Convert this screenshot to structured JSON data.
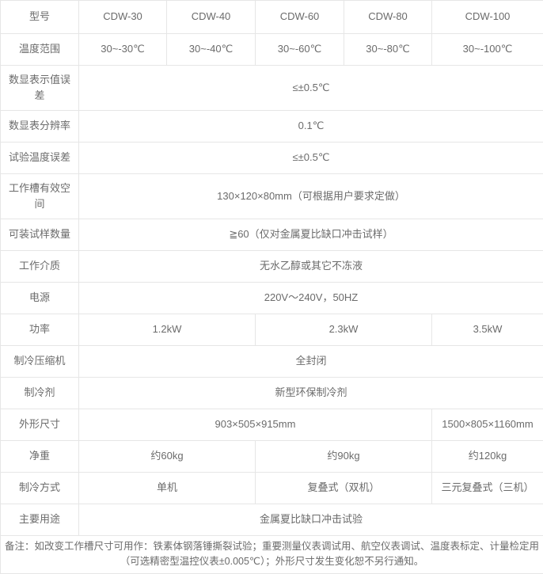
{
  "table": {
    "columns_count": 6,
    "header": {
      "label": "型号",
      "models": [
        "CDW-30",
        "CDW-40",
        "CDW-60",
        "CDW-80",
        "CDW-100"
      ]
    },
    "rows": [
      {
        "id": "temp-range",
        "label": "温度范围",
        "cells": [
          {
            "text": "30~-30℃",
            "span": 1
          },
          {
            "text": "30~-40℃",
            "span": 1
          },
          {
            "text": "30~-60℃",
            "span": 1
          },
          {
            "text": "30~-80℃",
            "span": 1
          },
          {
            "text": "30~-100℃",
            "span": 1
          }
        ]
      },
      {
        "id": "display-error",
        "label": "数显表示值误差",
        "tall": true,
        "cells": [
          {
            "text": "≤±0.5℃",
            "span": 5
          }
        ]
      },
      {
        "id": "display-resolution",
        "label": "数显表分辨率",
        "cells": [
          {
            "text": "0.1℃",
            "span": 5
          }
        ]
      },
      {
        "id": "test-temp-error",
        "label": "试验温度误差",
        "cells": [
          {
            "text": "≤±0.5℃",
            "span": 5
          }
        ]
      },
      {
        "id": "working-space",
        "label": "工作槽有效空间",
        "tall": true,
        "cells": [
          {
            "text": "130×120×80mm（可根据用户要求定做）",
            "span": 5
          }
        ]
      },
      {
        "id": "sample-capacity",
        "label": "可装试样数量",
        "cells": [
          {
            "text": "≧60（仅对金属夏比缺口冲击试样）",
            "span": 5
          }
        ]
      },
      {
        "id": "working-medium",
        "label": "工作介质",
        "cells": [
          {
            "text": "无水乙醇或其它不冻液",
            "span": 5
          }
        ]
      },
      {
        "id": "power-supply",
        "label": "电源",
        "cells": [
          {
            "text": "220V～240V，50HZ",
            "span": 5
          }
        ]
      },
      {
        "id": "power-rating",
        "label": "功率",
        "cells": [
          {
            "text": "1.2kW",
            "span": 2
          },
          {
            "text": "2.3kW",
            "span": 2
          },
          {
            "text": "3.5kW",
            "span": 1
          }
        ]
      },
      {
        "id": "compressor",
        "label": "制冷压缩机",
        "cells": [
          {
            "text": "全封闭",
            "span": 5
          }
        ]
      },
      {
        "id": "refrigerant",
        "label": "制冷剂",
        "cells": [
          {
            "text": "新型环保制冷剂",
            "span": 5
          }
        ]
      },
      {
        "id": "dimensions",
        "label": "外形尺寸",
        "cells": [
          {
            "text": "903×505×915mm",
            "span": 4
          },
          {
            "text": "1500×805×1160mm",
            "span": 1
          }
        ]
      },
      {
        "id": "net-weight",
        "label": "净重",
        "cells": [
          {
            "text": "约60kg",
            "span": 2
          },
          {
            "text": "约90kg",
            "span": 2
          },
          {
            "text": "约120kg",
            "span": 1
          }
        ]
      },
      {
        "id": "cooling-method",
        "label": "制冷方式",
        "cells": [
          {
            "text": "单机",
            "span": 2
          },
          {
            "text": "复叠式（双机）",
            "span": 2
          },
          {
            "text": "三元复叠式（三机）",
            "span": 1
          }
        ]
      },
      {
        "id": "main-usage",
        "label": "主要用途",
        "cells": [
          {
            "text": "金属夏比缺口冲击试验",
            "span": 5
          }
        ]
      }
    ],
    "note": {
      "line1": "备注：如改变工作槽尺寸可用作：铁素体钢落锤撕裂试验；重要测量仪表调试用、航空仪表调试、温度表标定、计量检定用",
      "line2": "（可选精密型温控仪表±0.005℃）；外形尺寸发生变化恕不另行通知。"
    }
  },
  "colors": {
    "border": "#e6e6e6",
    "text": "#6b6b6b",
    "background": "#ffffff"
  }
}
